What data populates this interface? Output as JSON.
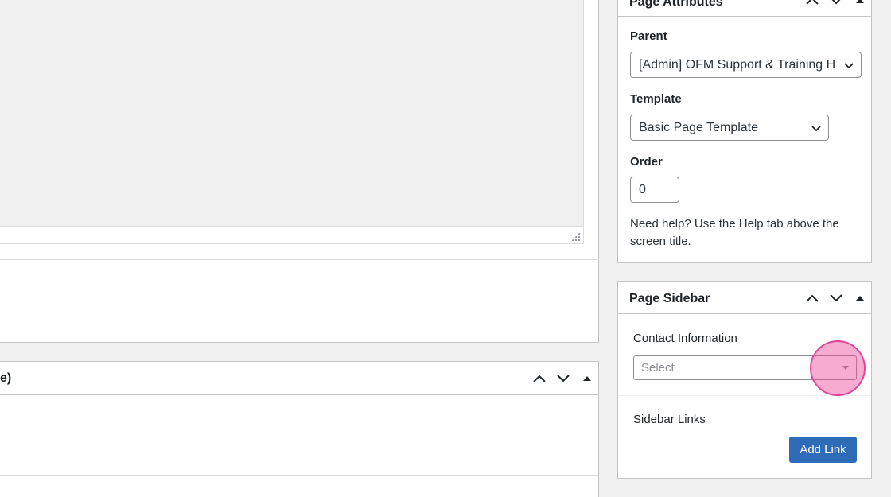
{
  "left": {
    "lower_box_title": "e)"
  },
  "page_attributes": {
    "title": "Page Attributes",
    "parent_label": "Parent",
    "parent_value": "[Admin] OFM Support & Training H",
    "template_label": "Template",
    "template_value": "Basic Page Template",
    "order_label": "Order",
    "order_value": "0",
    "help_text": "Need help? Use the Help tab above the screen title."
  },
  "page_sidebar": {
    "title": "Page Sidebar",
    "contact_label": "Contact Information",
    "contact_placeholder": "Select",
    "links_label": "Sidebar Links",
    "add_link_label": "Add Link"
  },
  "colors": {
    "accent": "#2e6cb8",
    "highlight": "#e0479a"
  }
}
